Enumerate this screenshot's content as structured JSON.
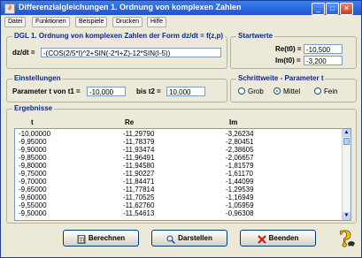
{
  "window": {
    "title": "Differenzialgleichungen 1. Ordnung von komplexen Zahlen"
  },
  "titlebar_buttons": {
    "minimize": "_",
    "maximize": "□",
    "close": "✕"
  },
  "menu": [
    "Datei",
    "Funktionen",
    "Beispiele",
    "Drucken",
    "Hilfe"
  ],
  "equation": {
    "group_title": "DGL 1. Ordnung von komplexen Zahlen der Form dz/dt = f(z,p)",
    "label": "dz/dt =",
    "value": "-(COS(2/5*I)^2+SIN(-2*I+Z)-12*SIN(I-5))"
  },
  "start_values": {
    "group_title": "Startwerte",
    "re_label": "Re(t0) =",
    "re_value": "-10,500",
    "im_label": "Im(t0) =",
    "im_value": "-3,200"
  },
  "settings": {
    "group_title": "Einstellungen",
    "param_label": "Parameter t von t1 =",
    "t1_value": "-10,000",
    "to_label": "bis t2 =",
    "t2_value": "10,000"
  },
  "step": {
    "group_title": "Schrittweite - Parameter t",
    "options": [
      "Grob",
      "Mittel",
      "Fein"
    ],
    "selected": "Mittel"
  },
  "results": {
    "group_title": "Ergebnisse",
    "headers": [
      "t",
      "Re",
      "Im"
    ],
    "rows": [
      [
        "-10,00000",
        "-11,29790",
        "-3,26234"
      ],
      [
        "-9,95000",
        "-11,78379",
        "-2,80451"
      ],
      [
        "-9,90000",
        "-11,93474",
        "-2,38605"
      ],
      [
        "-9,85000",
        "-11,96491",
        "-2,06657"
      ],
      [
        "-9,80000",
        "-11,94580",
        "-1,81579"
      ],
      [
        "-9,75000",
        "-11,90227",
        "-1,61170"
      ],
      [
        "-9,70000",
        "-11,84471",
        "-1,44099"
      ],
      [
        "-9,65000",
        "-11,77814",
        "-1,29539"
      ],
      [
        "-9,60000",
        "-11,70525",
        "-1,16949"
      ],
      [
        "-9,55000",
        "-11,62760",
        "-1,05959"
      ],
      [
        "-9,50000",
        "-11,54613",
        "-0,96308"
      ]
    ]
  },
  "buttons": {
    "calculate": "Berechnen",
    "display": "Darstellen",
    "exit": "Beenden"
  },
  "colors": {
    "title_blue": "#1d54d0",
    "group_title": "#0a2a8c",
    "radio_dot": "#21a121"
  }
}
